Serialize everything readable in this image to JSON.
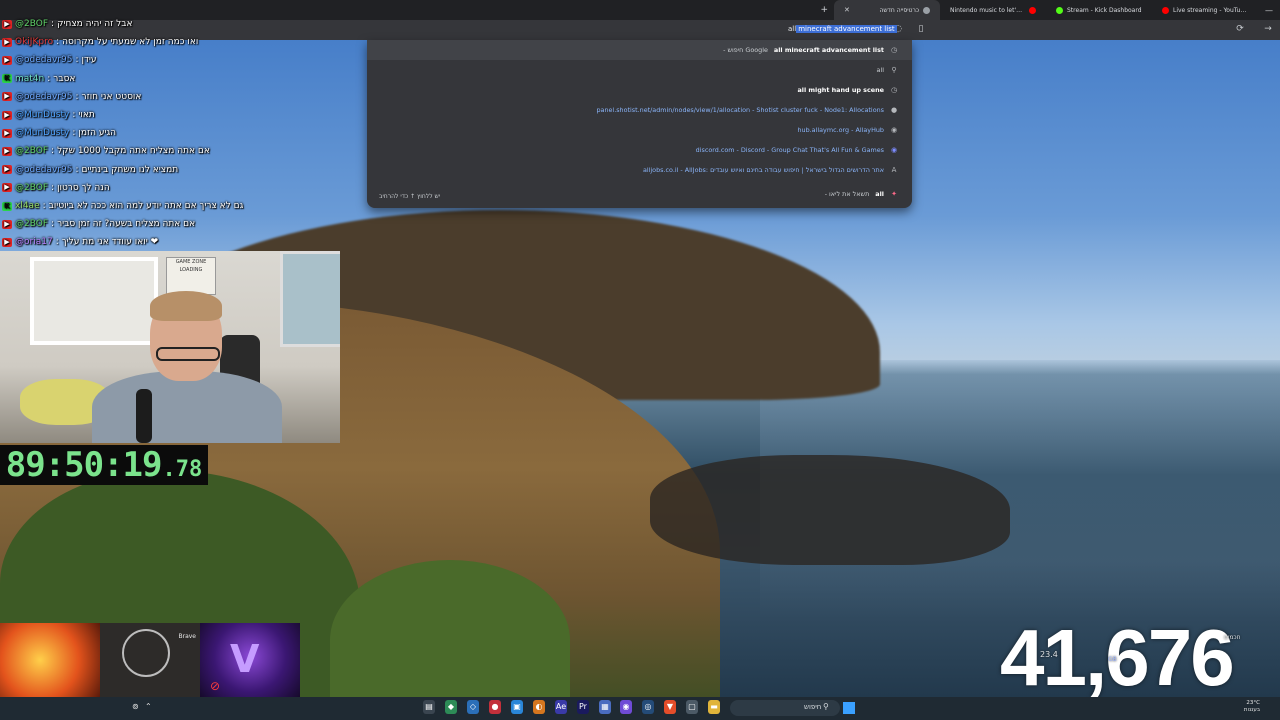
{
  "browser": {
    "tabs": [
      {
        "title": "Live streaming - YouTube Studio",
        "icon_color": "#ff0000"
      },
      {
        "title": "Stream - Kick Dashboard",
        "icon_color": "#53fc18"
      },
      {
        "title": "Nintendo music to let's work stu",
        "icon_color": "#ff0000"
      },
      {
        "title": "כרטיסייה חדשה",
        "icon_color": "#9aa0a6",
        "active": true
      }
    ],
    "new_tab_label": "+",
    "omnibox": {
      "typed": "all",
      "autocomplete": "minecraft advancement list"
    },
    "suggestions": [
      {
        "icon": "history-icon",
        "bold": "all minecraft advancement list",
        "rest": " - חיפוש Google",
        "url": ""
      },
      {
        "icon": "search-icon",
        "bold": "all",
        "rest": "",
        "url": ""
      },
      {
        "icon": "history-icon",
        "bold": "all might hand up scene",
        "rest": "",
        "url": ""
      },
      {
        "icon": "globe-icon",
        "bold": "",
        "rest": "panel.shotist.net/admin/nodes/view/1/allocation - Shotist cluster fuck - Node1: Allocations",
        "url": ""
      },
      {
        "icon": "site-icon",
        "bold": "",
        "rest": "hub.allaymc.org - AllayHub",
        "url": ""
      },
      {
        "icon": "discord-icon",
        "bold": "",
        "rest": "discord.com - Discord - Group Chat That's All Fun & Games",
        "url": ""
      },
      {
        "icon": "site-icon",
        "bold": "",
        "rest": "alljobs.co.il - AllJobs: אתר הדרושים הגדול בישראל | חיפוש עבודה בחינם ואיוש עובדים",
        "url": ""
      },
      {
        "icon": "star-icon",
        "bold": "all",
        "rest": " - תשאל את ליאו",
        "url": ""
      }
    ],
    "dropdown_footer": "יש ללחוץ ↑ כדי להרחיב"
  },
  "chat": [
    {
      "badge": "yt",
      "user": "@2BOF",
      "user_color": "#61d26a",
      "msg": "אבל זה יהיה מצחיק"
    },
    {
      "badge": "yt",
      "user": "OkiJKpro",
      "user_color": "#e23b3b",
      "msg": "ואו כמה זמן לא שמעתי על מקרוסה"
    },
    {
      "badge": "yt",
      "user": "@odedavr95",
      "user_color": "#6da8ff",
      "msg": "עידן"
    },
    {
      "badge": "kick",
      "user": "mat4n",
      "user_color": "#6fe0c7",
      "msg": "אסבר"
    },
    {
      "badge": "yt",
      "user": "@odedavr95",
      "user_color": "#6da8ff",
      "msg": "אוסטט אני חוזר"
    },
    {
      "badge": "yt",
      "user": "@MunDusty",
      "user_color": "#4fa3ff",
      "msg": "תאוי"
    },
    {
      "badge": "yt",
      "user": "@MunDusty",
      "user_color": "#4fa3ff",
      "msg": "הגיע הזמן"
    },
    {
      "badge": "yt",
      "user": "@2BOF",
      "user_color": "#61d26a",
      "msg": "אם אתה מצליח אתה מקבל 1000 שקל"
    },
    {
      "badge": "yt",
      "user": "@odedavr95",
      "user_color": "#6da8ff",
      "msg": "תמציא לנו משחק בינתיים"
    },
    {
      "badge": "yt",
      "user": "@2BOF",
      "user_color": "#61d26a",
      "msg": "הנה לך סרטון"
    },
    {
      "badge": "kick",
      "user": "xl4ae",
      "user_color": "#9adf6b",
      "msg": "גם לא צריך אם אתה יודע למה הוא ככה לא ביוטיוב"
    },
    {
      "badge": "yt",
      "user": "@2BOF",
      "user_color": "#61d26a",
      "msg": "אם אתה מצליח בשעה? זה זמן סביר"
    },
    {
      "badge": "yt",
      "user": "@oria17",
      "user_color": "#b784ff",
      "msg": "יואו עוודד אני מת עליך ❤"
    }
  ],
  "webcam": {
    "poster_line1": "GAME ZONE",
    "poster_line2": "LOADING"
  },
  "timer": {
    "main": "89:50:19",
    "fraction": ".78"
  },
  "tiles": {
    "sketch_label": "Brave",
    "purple_symbol": "V"
  },
  "viewer_count": "41,676",
  "side_overlay": {
    "temp": "23.4",
    "gb": "GB",
    "label_right": "חכמים"
  },
  "taskbar": {
    "search_label": "חיפוש",
    "tray_temp": "23°C",
    "tray_text": "בעננות"
  }
}
